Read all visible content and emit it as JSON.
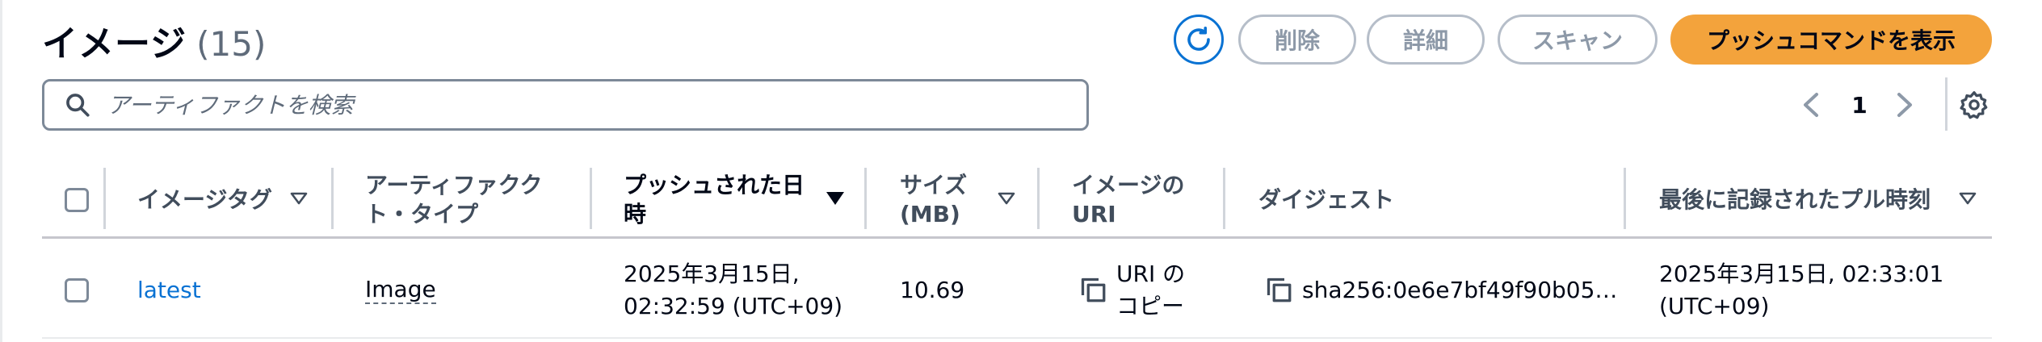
{
  "header": {
    "title": "イメージ",
    "count": "(15)"
  },
  "actions": {
    "delete_label": "削除",
    "details_label": "詳細",
    "scan_label": "スキャン",
    "push_label": "プッシュコマンドを表示"
  },
  "search": {
    "placeholder": "アーティファクトを検索"
  },
  "pagination": {
    "current_page": "1"
  },
  "table": {
    "columns": {
      "tag": "イメージタグ",
      "artifact_type_line1": "アーティファクク",
      "artifact_type_line2": "ト・タイプ",
      "pushed_line1": "プッシュされた日",
      "pushed_line2": "時",
      "size_line1": "サイズ",
      "size_line2": "(MB)",
      "uri_line1": "イメージの",
      "uri_line2": "URI",
      "digest": "ダイジェスト",
      "last_pull": "最後に記録されたプル時刻"
    },
    "rows": [
      {
        "tag": "latest",
        "artifact_type": "Image",
        "pushed_line1": "2025年3月15日,",
        "pushed_line2": "02:32:59 (UTC+09)",
        "size": "10.69",
        "uri_line1": "URI の",
        "uri_line2": "コピー",
        "digest": "sha256:0e6e7bf49f90b05…",
        "last_pull_line1": "2025年3月15日, 02:33:01",
        "last_pull_line2": "(UTC+09)"
      }
    ]
  },
  "colors": {
    "accent": "#0972d3",
    "primary_button": "#f3a33c",
    "disabled_text": "#8d99a8"
  },
  "icons": {
    "refresh": "refresh-icon",
    "search": "search-icon",
    "prev": "chevron-left-icon",
    "next": "chevron-right-icon",
    "settings": "gear-icon",
    "sort": "caret-down-icon",
    "copy": "copy-icon"
  }
}
